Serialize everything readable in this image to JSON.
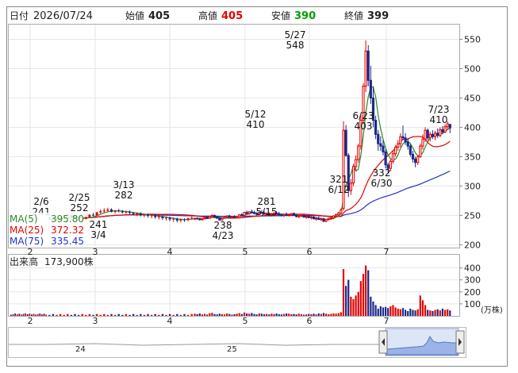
{
  "header": {
    "date_label": "日付",
    "date_value": "2026/07/24",
    "open_label": "始値",
    "open_value": "405",
    "high_label": "高値",
    "high_value": "405",
    "low_label": "安値",
    "low_value": "390",
    "close_label": "終値",
    "close_value": "399"
  },
  "colors": {
    "up": "#e60000",
    "down": "#1a2a8a",
    "ma5": "#2a8a2a",
    "ma25": "#e60000",
    "ma75": "#2233cc",
    "high_value": "#e60000",
    "low_value": "#00a000"
  },
  "legend": {
    "ma5_label": "MA(5)",
    "ma5_value": "395.80",
    "ma25_label": "MA(25)",
    "ma25_value": "372.32",
    "ma75_label": "MA(75)",
    "ma75_value": "335.45"
  },
  "volume": {
    "title": "出来高",
    "value": "173,900株",
    "unit": "(万株)",
    "ticks": [
      "100",
      "200",
      "300",
      "400"
    ]
  },
  "navigator": {
    "labels": [
      "24",
      "25"
    ]
  },
  "chart_data": {
    "type": "candlestick",
    "price_axis": {
      "ticks": [
        200,
        250,
        300,
        350,
        400,
        450,
        500,
        550
      ],
      "range": [
        195,
        575
      ]
    },
    "volume_axis": {
      "ticks": [
        100,
        200,
        300,
        400
      ],
      "range": [
        0,
        470
      ]
    },
    "x_labels": [
      "2",
      "3",
      "4",
      "5",
      "6",
      "7"
    ],
    "annotations": [
      {
        "date": "2/6",
        "value": "241"
      },
      {
        "date": "2/25",
        "value": "252"
      },
      {
        "date": "3/4",
        "value": "241"
      },
      {
        "date": "3/13",
        "value": "282"
      },
      {
        "date": "4/23",
        "value": "238"
      },
      {
        "date": "5/12",
        "value": "410"
      },
      {
        "date": "5/15",
        "value": "281"
      },
      {
        "date": "5/27",
        "value": "548"
      },
      {
        "date": "6/12",
        "value": "321"
      },
      {
        "date": "6/23",
        "value": "403"
      },
      {
        "date": "6/30",
        "value": "332"
      },
      {
        "date": "7/23",
        "value": "410"
      }
    ],
    "ohlc": [
      [
        244,
        246,
        242,
        245
      ],
      [
        245,
        247,
        243,
        244
      ],
      [
        244,
        246,
        241,
        243
      ],
      [
        243,
        245,
        241,
        244
      ],
      [
        244,
        247,
        243,
        246
      ],
      [
        246,
        248,
        244,
        245
      ],
      [
        245,
        249,
        244,
        248
      ],
      [
        248,
        252,
        247,
        250
      ],
      [
        250,
        251,
        246,
        247
      ],
      [
        247,
        249,
        244,
        245
      ],
      [
        245,
        247,
        241,
        242
      ],
      [
        242,
        246,
        241,
        245
      ],
      [
        245,
        248,
        244,
        247
      ],
      [
        247,
        250,
        246,
        249
      ],
      [
        249,
        251,
        246,
        247
      ],
      [
        247,
        249,
        245,
        248
      ],
      [
        248,
        250,
        246,
        246
      ],
      [
        246,
        249,
        245,
        248
      ],
      [
        248,
        252,
        247,
        251
      ],
      [
        251,
        254,
        249,
        250
      ],
      [
        250,
        256,
        249,
        255
      ],
      [
        255,
        258,
        252,
        253
      ],
      [
        253,
        257,
        251,
        256
      ],
      [
        256,
        260,
        254,
        255
      ],
      [
        255,
        258,
        252,
        253
      ],
      [
        253,
        255,
        250,
        252
      ],
      [
        252,
        256,
        251,
        255
      ],
      [
        255,
        259,
        253,
        254
      ],
      [
        254,
        257,
        251,
        252
      ],
      [
        252,
        255,
        249,
        253
      ],
      [
        253,
        255,
        250,
        251
      ],
      [
        251,
        254,
        248,
        252
      ],
      [
        252,
        255,
        250,
        254
      ],
      [
        254,
        257,
        252,
        253
      ],
      [
        253,
        256,
        250,
        251
      ],
      [
        251,
        253,
        248,
        250
      ],
      [
        250,
        253,
        247,
        252
      ],
      [
        252,
        255,
        249,
        250
      ],
      [
        250,
        253,
        248,
        251
      ],
      [
        251,
        254,
        249,
        253
      ],
      [
        253,
        255,
        249,
        250
      ],
      [
        250,
        252,
        246,
        248
      ],
      [
        248,
        251,
        245,
        249
      ],
      [
        249,
        252,
        247,
        250
      ],
      [
        250,
        252,
        246,
        247
      ],
      [
        247,
        250,
        244,
        248
      ],
      [
        248,
        251,
        245,
        246
      ],
      [
        246,
        249,
        243,
        247
      ],
      [
        247,
        249,
        243,
        244
      ],
      [
        244,
        247,
        241,
        245
      ],
      [
        245,
        248,
        242,
        243
      ],
      [
        243,
        246,
        240,
        244
      ],
      [
        244,
        246,
        238,
        240
      ],
      [
        240,
        244,
        238,
        243
      ],
      [
        243,
        246,
        241,
        245
      ],
      [
        245,
        248,
        243,
        246
      ],
      [
        246,
        250,
        244,
        249
      ],
      [
        249,
        253,
        247,
        251
      ],
      [
        251,
        256,
        249,
        254
      ],
      [
        254,
        262,
        252,
        259
      ],
      [
        262,
        410,
        258,
        395
      ],
      [
        395,
        404,
        350,
        352
      ],
      [
        352,
        356,
        281,
        292
      ],
      [
        292,
        312,
        285,
        305
      ],
      [
        305,
        338,
        300,
        333
      ],
      [
        333,
        352,
        325,
        345
      ],
      [
        345,
        372,
        340,
        368
      ],
      [
        368,
        420,
        362,
        412
      ],
      [
        412,
        475,
        405,
        470
      ],
      [
        470,
        548,
        460,
        530
      ],
      [
        530,
        540,
        470,
        480
      ],
      [
        480,
        505,
        440,
        450
      ],
      [
        450,
        470,
        400,
        412
      ],
      [
        412,
        420,
        380,
        388
      ],
      [
        388,
        395,
        360,
        372
      ],
      [
        372,
        385,
        360,
        368
      ],
      [
        368,
        378,
        352,
        358
      ],
      [
        358,
        362,
        330,
        336
      ],
      [
        336,
        340,
        321,
        330
      ],
      [
        330,
        346,
        325,
        342
      ],
      [
        342,
        360,
        338,
        355
      ],
      [
        355,
        370,
        350,
        366
      ],
      [
        366,
        378,
        360,
        372
      ],
      [
        372,
        390,
        366,
        384
      ],
      [
        384,
        403,
        378,
        382
      ],
      [
        382,
        390,
        370,
        375
      ],
      [
        375,
        382,
        362,
        368
      ],
      [
        368,
        372,
        350,
        354
      ],
      [
        354,
        360,
        340,
        346
      ],
      [
        346,
        350,
        332,
        340
      ],
      [
        340,
        352,
        336,
        350
      ],
      [
        350,
        372,
        348,
        368
      ],
      [
        368,
        388,
        362,
        380
      ],
      [
        380,
        400,
        375,
        395
      ],
      [
        395,
        398,
        378,
        382
      ],
      [
        382,
        392,
        376,
        388
      ],
      [
        388,
        395,
        380,
        384
      ],
      [
        384,
        394,
        378,
        390
      ],
      [
        390,
        398,
        382,
        386
      ],
      [
        386,
        400,
        383,
        396
      ],
      [
        396,
        402,
        388,
        392
      ],
      [
        392,
        405,
        390,
        401
      ],
      [
        401,
        410,
        395,
        406
      ],
      [
        405,
        405,
        390,
        399
      ]
    ],
    "volumes": [
      18,
      14,
      20,
      12,
      16,
      10,
      22,
      25,
      15,
      12,
      18,
      14,
      12,
      20,
      16,
      10,
      14,
      18,
      22,
      15,
      28,
      20,
      18,
      24,
      16,
      12,
      20,
      18,
      14,
      16,
      12,
      18,
      15,
      20,
      14,
      12,
      16,
      20,
      18,
      14,
      16,
      12,
      18,
      14,
      10,
      12,
      16,
      14,
      18,
      12,
      20,
      16,
      24,
      18,
      14,
      16,
      20,
      18,
      22,
      30,
      390,
      250,
      300,
      160,
      140,
      170,
      200,
      290,
      350,
      420,
      380,
      160,
      120,
      90,
      60,
      80,
      70,
      75,
      65,
      80,
      90,
      70,
      60,
      55,
      65,
      50,
      40,
      60,
      50,
      45,
      55,
      170,
      130,
      90,
      50,
      45,
      40,
      50,
      55,
      45,
      60,
      50,
      55,
      45
    ],
    "ma5": [],
    "ma25": [],
    "ma75": []
  }
}
